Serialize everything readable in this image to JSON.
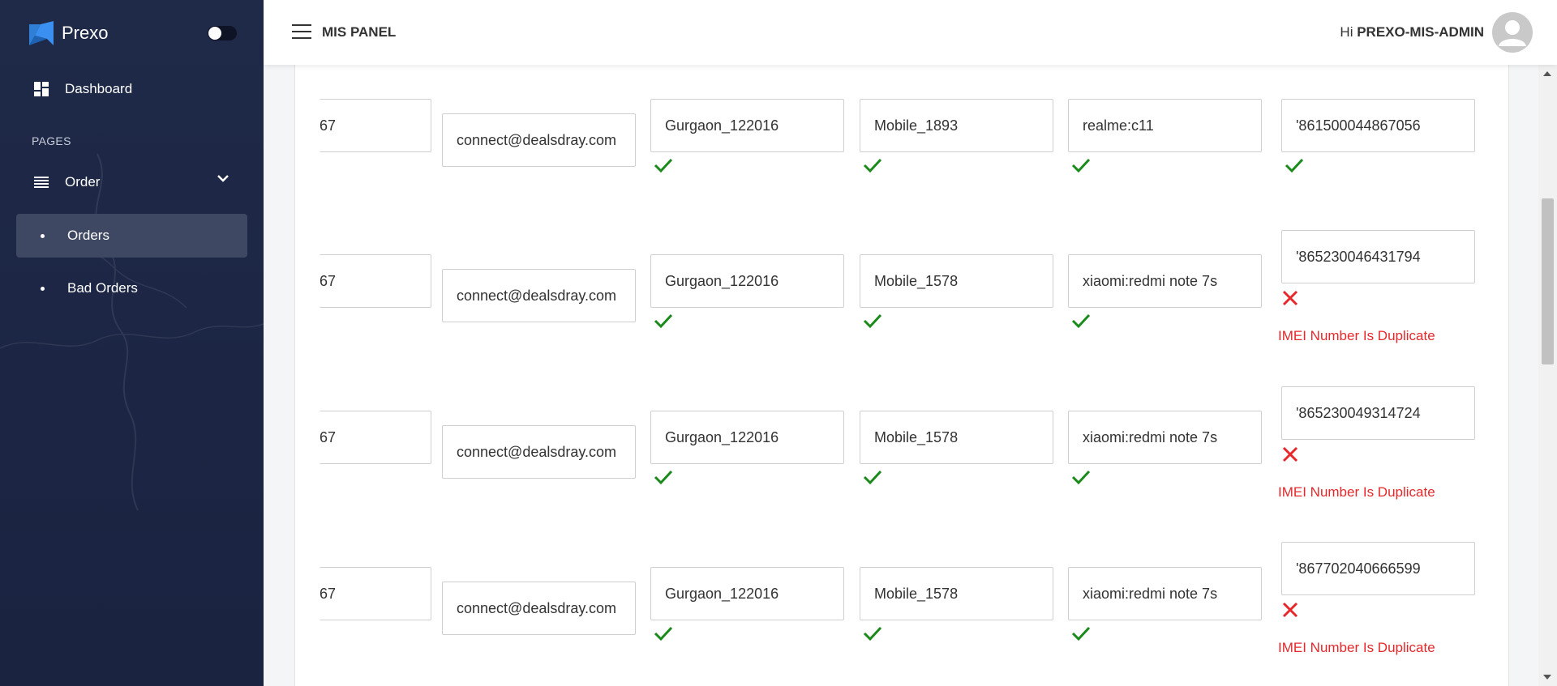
{
  "sidebar": {
    "brand": "Prexo",
    "dashboard_label": "Dashboard",
    "section_label": "PAGES",
    "order_label": "Order",
    "sub_items": [
      "Orders",
      "Bad Orders"
    ]
  },
  "header": {
    "title": "MIS PANEL",
    "greeting_prefix": "Hi",
    "user": "PREXO-MIS-ADMIN"
  },
  "rows": [
    {
      "partial": "67",
      "email": "connect@dealsdray.com",
      "location": "Gurgaon_122016",
      "model": "Mobile_1893",
      "brand": "realme:c11",
      "imei": "'861500044867056",
      "imei_valid": true,
      "error": ""
    },
    {
      "partial": "67",
      "email": "connect@dealsdray.com",
      "location": "Gurgaon_122016",
      "model": "Mobile_1578",
      "brand": "xiaomi:redmi note 7s",
      "imei": "'865230046431794",
      "imei_valid": false,
      "error": "IMEI Number Is Duplicate"
    },
    {
      "partial": "67",
      "email": "connect@dealsdray.com",
      "location": "Gurgaon_122016",
      "model": "Mobile_1578",
      "brand": "xiaomi:redmi note 7s",
      "imei": "'865230049314724",
      "imei_valid": false,
      "error": "IMEI Number Is Duplicate"
    },
    {
      "partial": "67",
      "email": "connect@dealsdray.com",
      "location": "Gurgaon_122016",
      "model": "Mobile_1578",
      "brand": "xiaomi:redmi note 7s",
      "imei": "'867702040666599",
      "imei_valid": false,
      "error": "IMEI Number Is Duplicate"
    }
  ],
  "colors": {
    "sidebar_bg": "#1f2a48",
    "active_item_bg": "#3f4862",
    "valid": "#1a8a1a",
    "error": "#e5282b"
  }
}
